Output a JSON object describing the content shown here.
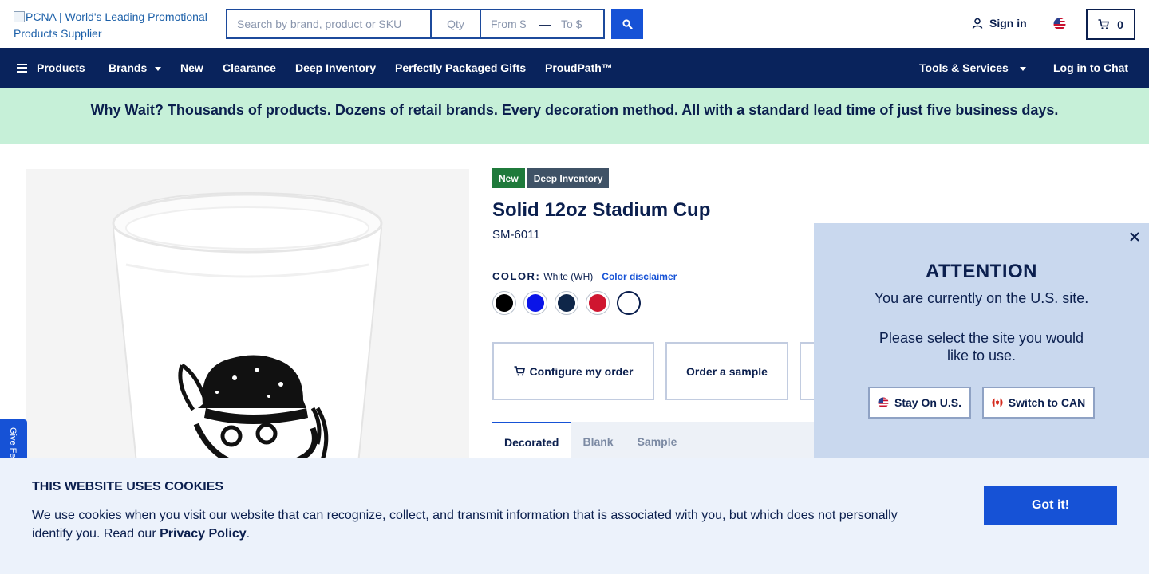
{
  "header": {
    "logo_alt": "PCNA | World's Leading Promotional Products Supplier",
    "search_placeholder": "Search by brand, product or SKU",
    "qty_placeholder": "Qty",
    "from_placeholder": "From $",
    "price_dash": "—",
    "to_placeholder": "To $",
    "signin_label": "Sign in",
    "cart_count": "0"
  },
  "nav": {
    "products": "Products",
    "brands": "Brands",
    "new": "New",
    "clearance": "Clearance",
    "deep_inventory": "Deep Inventory",
    "gifts": "Perfectly Packaged Gifts",
    "proudpath": "ProudPath™",
    "tools": "Tools & Services",
    "chat": "Log in to Chat"
  },
  "promo": {
    "text": "Why Wait? Thousands of products. Dozens of retail brands. Every decoration method. All with a standard lead time of just five business days."
  },
  "feedback": {
    "label": "Give Feedback"
  },
  "product": {
    "badges": {
      "new": "New",
      "deep": "Deep Inventory"
    },
    "title": "Solid 12oz Stadium Cup",
    "sku": "SM-6011",
    "color_label": "COLOR:",
    "color_value": "White (WH)",
    "color_disclaimer": "Color disclaimer",
    "swatches": [
      {
        "name": "Black",
        "hex": "#000000"
      },
      {
        "name": "Blue",
        "hex": "#0a14e8"
      },
      {
        "name": "Navy",
        "hex": "#0f2649"
      },
      {
        "name": "Red",
        "hex": "#cf1630"
      },
      {
        "name": "White",
        "hex": "#ffffff"
      }
    ],
    "actions": {
      "configure": "Configure my order",
      "sample": "Order a sample"
    },
    "tabs": {
      "decorated": "Decorated",
      "blank": "Blank",
      "sample": "Sample"
    }
  },
  "attention": {
    "title": "ATTENTION",
    "msg1": "You are currently on the U.S. site.",
    "msg2": "Please select the site you would like to use.",
    "stay": "Stay On U.S.",
    "switch": "Switch to CAN"
  },
  "cookie": {
    "title": "THIS WEBSITE USES COOKIES",
    "text": "We use cookies when you visit our website that can recognize, collect, and transmit information that is associated with you, but which does not personally identify you. Read our ",
    "link": "Privacy Policy",
    "period": ".",
    "button": "Got it!"
  },
  "colors": {
    "navy": "#09235c",
    "accent": "#1652d6",
    "promo_bg": "#c6f0d8",
    "badge_new": "#1f7a3b",
    "badge_deep": "#3f5266"
  }
}
